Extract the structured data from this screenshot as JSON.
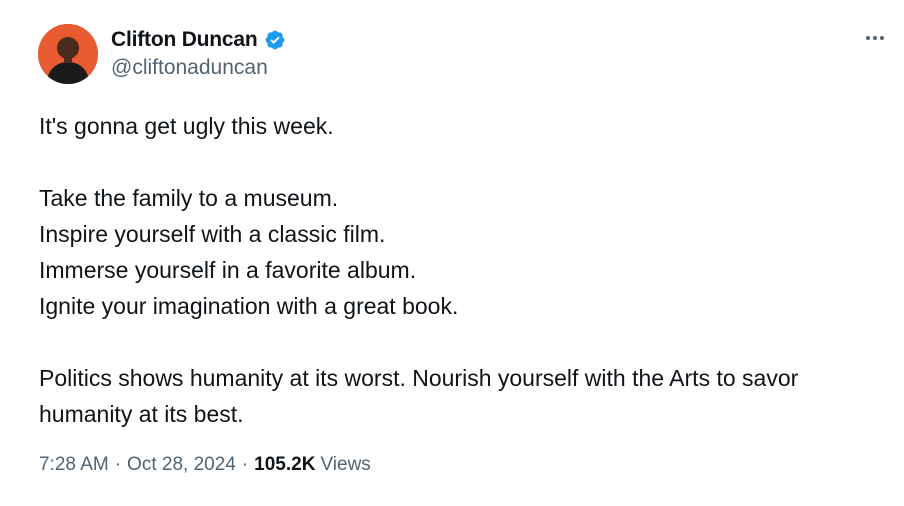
{
  "author": {
    "display_name": "Clifton Duncan",
    "handle": "@cliftonaduncan",
    "verified": true,
    "avatar_bg": "#e85a2f"
  },
  "colors": {
    "verified_badge": "#1d9bf0",
    "secondary_text": "#536471",
    "primary_text": "#0f1419"
  },
  "tweet": {
    "lines": [
      "It's gonna get ugly this week.",
      "",
      "Take the family to a museum.",
      "Inspire yourself with a classic film.",
      "Immerse yourself in a favorite album.",
      "Ignite your imagination with a great book.",
      "",
      "Politics shows humanity at its worst. Nourish yourself with the Arts to savor humanity at its best."
    ]
  },
  "meta": {
    "time": "7:28 AM",
    "date": "Oct 28, 2024",
    "separator": "·",
    "views_count": "105.2K",
    "views_label": "Views"
  },
  "icons": {
    "more": "more-horizontal-icon",
    "verified": "verified-badge-icon"
  }
}
